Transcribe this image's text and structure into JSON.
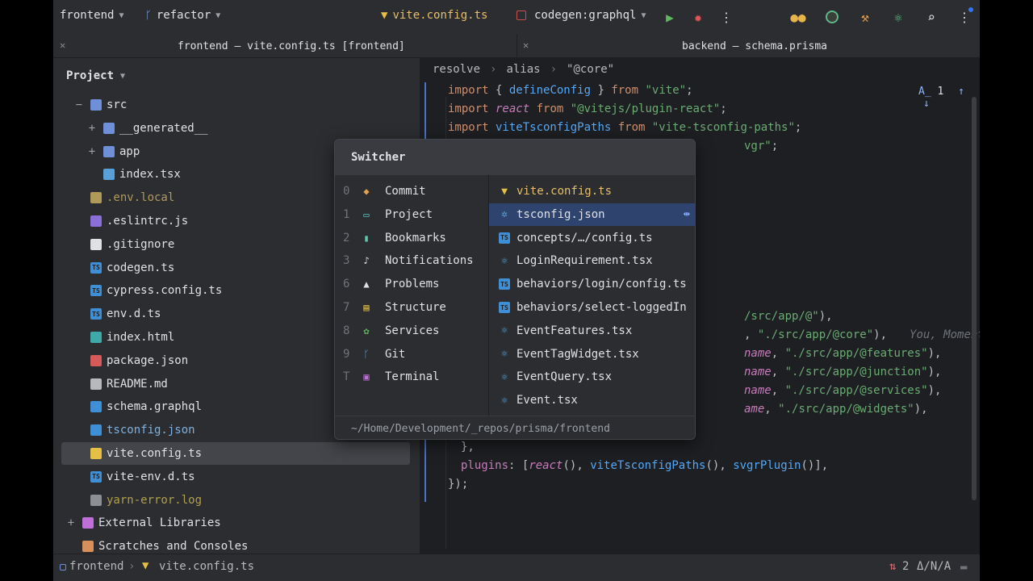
{
  "toolbar": {
    "project": "frontend",
    "branch": "refactor",
    "current_file": "vite.config.ts",
    "run_config": "codegen:graphql"
  },
  "tabs": {
    "left": "frontend – vite.config.ts [frontend]",
    "right": "backend – schema.prisma"
  },
  "project_panel": {
    "title": "Project",
    "items": [
      {
        "label": "src",
        "type": "folder",
        "expanded": "−"
      },
      {
        "label": "__generated__",
        "type": "folder",
        "expanded": "+"
      },
      {
        "label": "app",
        "type": "folder",
        "expanded": "+"
      },
      {
        "label": "index.tsx",
        "type": "tsx"
      },
      {
        "label": ".env.local",
        "type": "env"
      },
      {
        "label": ".eslintrc.js",
        "type": "eslint"
      },
      {
        "label": ".gitignore",
        "type": "git"
      },
      {
        "label": "codegen.ts",
        "type": "ts"
      },
      {
        "label": "cypress.config.ts",
        "type": "ts"
      },
      {
        "label": "env.d.ts",
        "type": "ts"
      },
      {
        "label": "index.html",
        "type": "html"
      },
      {
        "label": "package.json",
        "type": "json"
      },
      {
        "label": "README.md",
        "type": "md"
      },
      {
        "label": "schema.graphql",
        "type": "graphql"
      },
      {
        "label": "tsconfig.json",
        "type": "tsconfig"
      },
      {
        "label": "vite.config.ts",
        "type": "vite"
      },
      {
        "label": "vite-env.d.ts",
        "type": "ts"
      },
      {
        "label": "yarn-error.log",
        "type": "log"
      },
      {
        "label": "External Libraries",
        "type": "lib",
        "expanded": "+"
      },
      {
        "label": "Scratches and Consoles",
        "type": "scratch"
      }
    ]
  },
  "editor": {
    "breadcrumbs": [
      "resolve",
      "alias",
      "\"@core\""
    ],
    "inspection_count": "1",
    "blame_hint": "You, Moments ago",
    "code": {
      "l1_kw": "import",
      "l1_a": " { ",
      "l1_fn": "defineConfig",
      "l1_b": " } ",
      "l1_from": "from",
      "l1_str": " \"vite\"",
      "l1_end": ";",
      "l2_kw": "import",
      "l2_it": " react",
      "l2_from": " from",
      "l2_str": " \"@vitejs/plugin-react\"",
      "l2_end": ";",
      "l3_kw": "import",
      "l3_fn": " viteTsconfigPaths",
      "l3_from": " from",
      "l3_str": " \"vite-tsconfig-paths\"",
      "l3_end": ";",
      "l4_str": "vgr\"",
      "l4_end": ";",
      "l5_str": "/src/app/@\"",
      "l5_end": "),",
      "l6_a": ", ",
      "l6_str": "\"./src/app/@core\"",
      "l6_end": "),",
      "l7_it": "name",
      "l7_a": ", ",
      "l7_str": "\"./src/app/@features\"",
      "l7_end": "),",
      "l8_it": "name",
      "l8_a": ", ",
      "l8_str": "\"./src/app/@junction\"",
      "l8_end": "),",
      "l9_it": "name",
      "l9_a": ", ",
      "l9_str": "\"./src/app/@services\"",
      "l9_end": "),",
      "l10_it": "ame",
      "l10_a": ", ",
      "l10_str": "\"./src/app/@widgets\"",
      "l10_end": "),",
      "l11": "},",
      "l12_prop": "plugins",
      "l12_a": ": [",
      "l12_it": "react",
      "l12_b": "(), ",
      "l12_fn1": "viteTsconfigPaths",
      "l12_c": "(), ",
      "l12_fn2": "svgrPlugin",
      "l12_d": "()],",
      "l13": "});"
    }
  },
  "switcher": {
    "title": "Switcher",
    "tool_windows": [
      {
        "key": "0",
        "label": "Commit",
        "icon": "commit-icon"
      },
      {
        "key": "1",
        "label": "Project",
        "icon": "project-icon"
      },
      {
        "key": "2",
        "label": "Bookmarks",
        "icon": "bookmark-icon"
      },
      {
        "key": "3",
        "label": "Notifications",
        "icon": "bell-icon"
      },
      {
        "key": "6",
        "label": "Problems",
        "icon": "problems-icon"
      },
      {
        "key": "7",
        "label": "Structure",
        "icon": "structure-icon"
      },
      {
        "key": "8",
        "label": "Services",
        "icon": "services-icon"
      },
      {
        "key": "9",
        "label": "Git",
        "icon": "git-icon"
      },
      {
        "key": "T",
        "label": "Terminal",
        "icon": "terminal-icon"
      }
    ],
    "recent_files": [
      {
        "label": "vite.config.ts",
        "type": "vite"
      },
      {
        "label": "tsconfig.json",
        "type": "tsconfig"
      },
      {
        "label": "concepts/…/config.ts",
        "type": "ts"
      },
      {
        "label": "LoginRequirement.tsx",
        "type": "react"
      },
      {
        "label": "behaviors/login/config.ts",
        "type": "ts"
      },
      {
        "label": "behaviors/select-loggedIn",
        "type": "ts"
      },
      {
        "label": "EventFeatures.tsx",
        "type": "react"
      },
      {
        "label": "EventTagWidget.tsx",
        "type": "react"
      },
      {
        "label": "EventQuery.tsx",
        "type": "react"
      },
      {
        "label": "Event.tsx",
        "type": "react"
      }
    ],
    "footer_path": "~/Home/Development/_repos/prisma/frontend"
  },
  "statusbar": {
    "project": "frontend",
    "file": "vite.config.ts",
    "vcs_count": "2",
    "position": "Δ/N/A"
  },
  "colors": {
    "accent": "#3574f0",
    "selection": "#2e436e",
    "panel": "#2b2d30",
    "editor": "#1e1f22"
  }
}
